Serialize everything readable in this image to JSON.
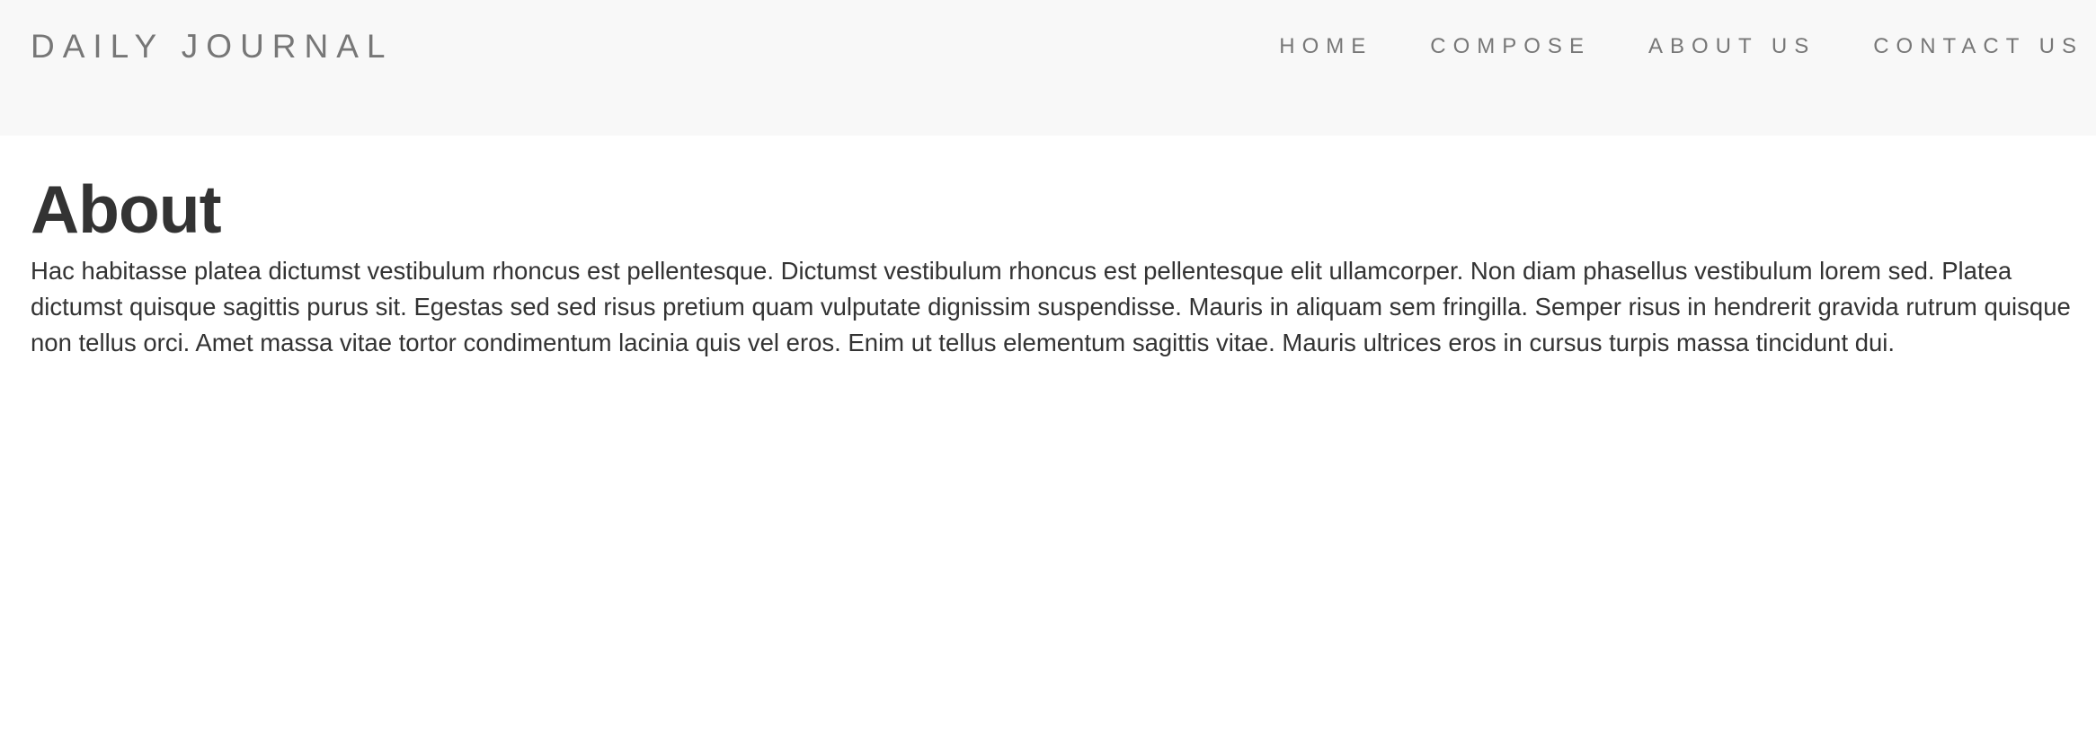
{
  "navbar": {
    "brand": "DAILY JOURNAL",
    "links": [
      {
        "label": "HOME"
      },
      {
        "label": "COMPOSE"
      },
      {
        "label": "ABOUT US"
      },
      {
        "label": "CONTACT US"
      }
    ]
  },
  "main": {
    "title": "About",
    "paragraph": "Hac habitasse platea dictumst vestibulum rhoncus est pellentesque. Dictumst vestibulum rhoncus est pellentesque elit ullamcorper. Non diam phasellus vestibulum lorem sed. Platea dictumst quisque sagittis purus sit. Egestas sed sed risus pretium quam vulputate dignissim suspendisse. Mauris in aliquam sem fringilla. Semper risus in hendrerit gravida rutrum quisque non tellus orci. Amet massa vitae tortor condimentum lacinia quis vel eros. Enim ut tellus elementum sagittis vitae. Mauris ultrices eros in cursus turpis massa tincidunt dui."
  },
  "colors": {
    "navbar_background": "#f8f8f8",
    "nav_text": "#777777",
    "body_text": "#333333",
    "page_background": "#ffffff"
  }
}
